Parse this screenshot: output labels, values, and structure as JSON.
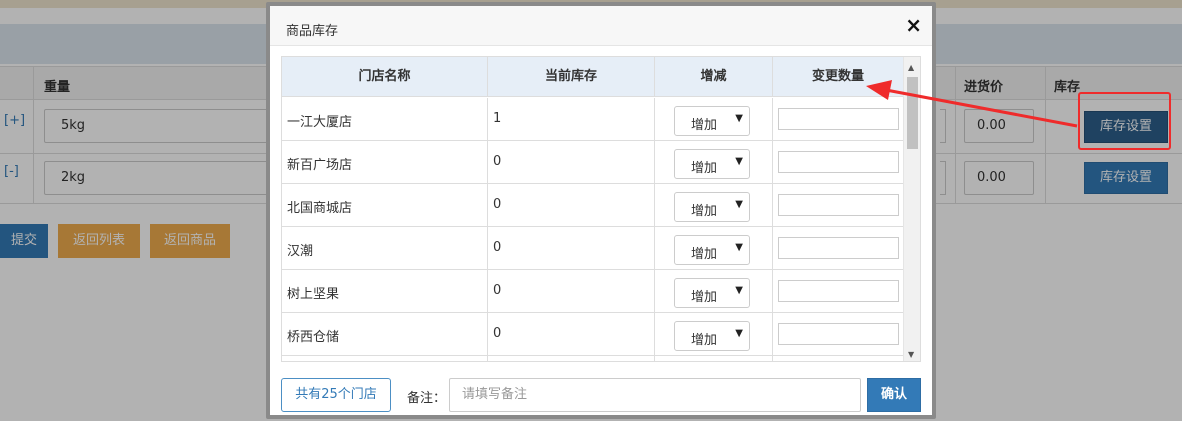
{
  "background": {
    "columns": {
      "weight": "重量",
      "cost_price": "进货价",
      "stock": "库存"
    },
    "rows": [
      {
        "toggle": "[+]",
        "weight": "5kg",
        "price": "0.00",
        "stock_button": "库存设置"
      },
      {
        "toggle": "[-]",
        "weight": "2kg",
        "price": "0.00",
        "stock_button": "库存设置"
      }
    ],
    "buttons": {
      "submit": "提交",
      "back_list": "返回列表",
      "back_goods": "返回商品"
    }
  },
  "modal": {
    "title": "商品库存",
    "close_icon": "×",
    "columns": {
      "store": "门店名称",
      "current": "当前库存",
      "change": "增减",
      "qty": "变更数量"
    },
    "rows": [
      {
        "store": "一江大厦店",
        "current": "1",
        "op": "增加"
      },
      {
        "store": "新百广场店",
        "current": "0",
        "op": "增加"
      },
      {
        "store": "北国商城店",
        "current": "0",
        "op": "增加"
      },
      {
        "store": "汉潮",
        "current": "0",
        "op": "增加"
      },
      {
        "store": "树上坚果",
        "current": "0",
        "op": "增加"
      },
      {
        "store": "桥西仓储",
        "current": "0",
        "op": "增加"
      }
    ],
    "footer": {
      "store_count": "共有25个门店",
      "remark_label": "备注：",
      "remark_placeholder": "请填写备注",
      "confirm": "确认"
    }
  },
  "colors": {
    "primary": "#337ab7",
    "warning": "#f0ad4e",
    "annotation": "#ef2b2b"
  }
}
